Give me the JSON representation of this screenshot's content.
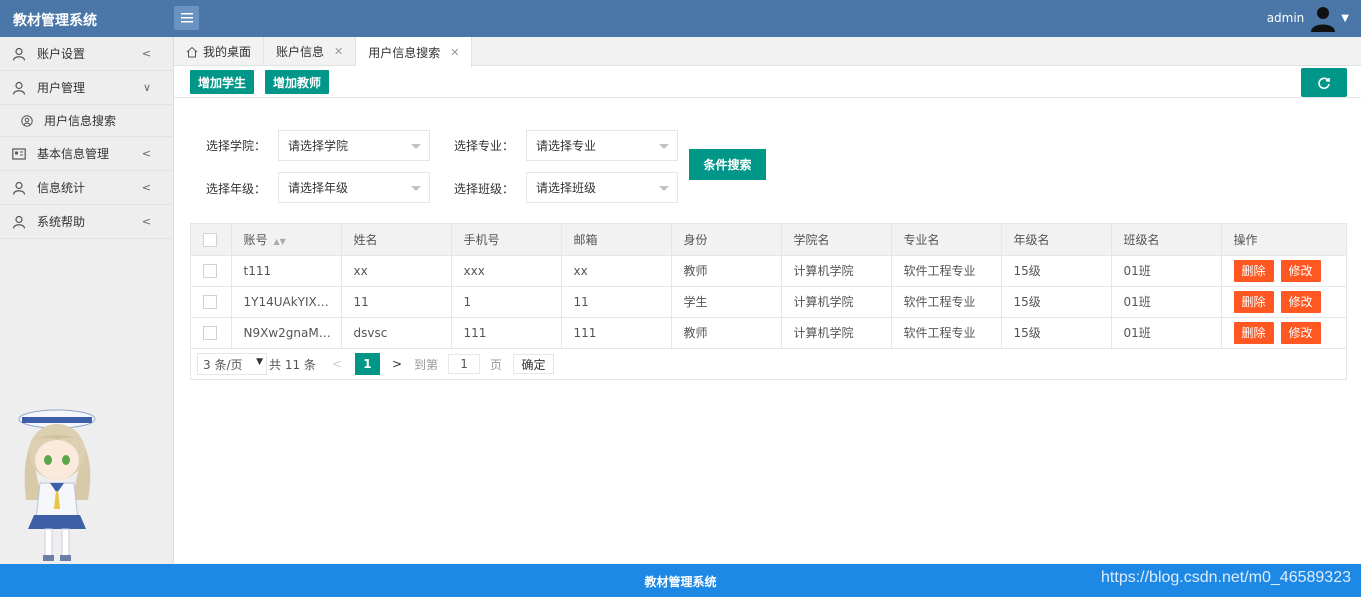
{
  "app": {
    "title": "教材管理系统"
  },
  "user": {
    "name": "admin"
  },
  "sidebar": {
    "items": [
      {
        "label": "账户设置",
        "icon": "user-icon"
      },
      {
        "label": "用户管理",
        "icon": "user-icon",
        "expanded": true,
        "children": [
          {
            "label": "用户信息搜索",
            "icon": "user-circle-icon"
          }
        ]
      },
      {
        "label": "基本信息管理",
        "icon": "id-card-icon"
      },
      {
        "label": "信息统计",
        "icon": "user-icon"
      },
      {
        "label": "系统帮助",
        "icon": "user-icon"
      }
    ]
  },
  "tabs": [
    {
      "label": "我的桌面",
      "closable": false
    },
    {
      "label": "账户信息",
      "closable": true
    },
    {
      "label": "用户信息搜索",
      "closable": true,
      "active": true
    }
  ],
  "toolbar": {
    "add_student": "增加学生",
    "add_teacher": "增加教师"
  },
  "filters": {
    "college_label": "选择学院：",
    "college_placeholder": "请选择学院",
    "major_label": "选择专业：",
    "major_placeholder": "请选择专业",
    "grade_label": "选择年级：",
    "grade_placeholder": "请选择年级",
    "class_label": "选择班级：",
    "class_placeholder": "请选择班级",
    "search_button": "条件搜索"
  },
  "table": {
    "headers": [
      "账号",
      "姓名",
      "手机号",
      "邮箱",
      "身份",
      "学院名",
      "专业名",
      "年级名",
      "班级名",
      "操作"
    ],
    "rows": [
      {
        "account": "t111",
        "name": "xx",
        "phone": "xxx",
        "email": "xx",
        "role": "教师",
        "college": "计算机学院",
        "major": "软件工程专业",
        "grade": "15级",
        "class": "01班"
      },
      {
        "account": "1Y14UAkYIX…",
        "name": "11",
        "phone": "1",
        "email": "11",
        "role": "学生",
        "college": "计算机学院",
        "major": "软件工程专业",
        "grade": "15级",
        "class": "01班"
      },
      {
        "account": "N9Xw2gnaM…",
        "name": "dsvsc",
        "phone": "111",
        "email": "111",
        "role": "教师",
        "college": "计算机学院",
        "major": "软件工程专业",
        "grade": "15级",
        "class": "01班"
      }
    ],
    "delete_label": "删除",
    "edit_label": "修改"
  },
  "pagination": {
    "per_page": "3 条/页",
    "total": "共 11 条",
    "current_page": "1",
    "goto_label": "到第",
    "goto_value": "1",
    "page_unit": "页",
    "confirm": "确定"
  },
  "footer": {
    "title": "教材管理系统",
    "watermark": "https://blog.csdn.net/m0_46589323"
  },
  "colors": {
    "header": "#4a76a8",
    "primary": "#009688",
    "danger": "#ff5722",
    "footer": "#1e88e5"
  }
}
